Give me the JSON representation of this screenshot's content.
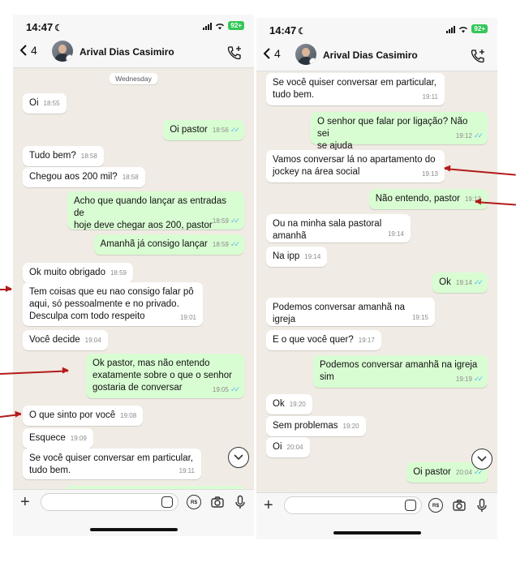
{
  "left": {
    "status": {
      "time": "14:47",
      "battery": "92+"
    },
    "header": {
      "back_count": "4",
      "contact_name": "Arival Dias Casimiro"
    },
    "day_chip": "Wednesday",
    "messages": [
      {
        "dir": "in",
        "text": "Oi",
        "time": "18:55"
      },
      {
        "dir": "out",
        "text": "Oi pastor",
        "time": "18:56",
        "read": true
      },
      {
        "dir": "in",
        "text": "Tudo bem?",
        "time": "18:58"
      },
      {
        "dir": "in",
        "text": "Chegou aos 200 mil?",
        "time": "18:58"
      },
      {
        "dir": "out",
        "text": "Acho que quando lançar as entradas de\nhoje deve chegar aos 200, pastor",
        "time": "18:59",
        "read": true
      },
      {
        "dir": "out",
        "text": "Amanhã já consigo lançar",
        "time": "18:59",
        "read": true
      },
      {
        "dir": "in",
        "text": "Ok muito obrigado",
        "time": "18:59"
      },
      {
        "dir": "in",
        "text": "Tem coisas que eu nao consigo falar pô\naqui, só pessoalmente e no privado.\nDesculpa com todo respeito",
        "time": "19:01"
      },
      {
        "dir": "in",
        "text": "Você decide",
        "time": "19:04"
      },
      {
        "dir": "out",
        "text": "Ok pastor, mas não entendo\nexatamente sobre o que o senhor\ngostaria de conversar",
        "time": "19:05",
        "read": true
      },
      {
        "dir": "in",
        "text": "O que sinto por você",
        "time": "19:08"
      },
      {
        "dir": "in",
        "text": "Esquece",
        "time": "19:09"
      },
      {
        "dir": "in",
        "text": "Se você quiser conversar em particular,\ntudo bem.",
        "time": "19:11"
      }
    ]
  },
  "right": {
    "status": {
      "time": "14:47",
      "battery": "92+"
    },
    "header": {
      "back_count": "4",
      "contact_name": "Arival Dias Casimiro"
    },
    "messages": [
      {
        "dir": "in",
        "text": "Se você quiser conversar em particular,\ntudo bem.",
        "time": "19:11"
      },
      {
        "dir": "out",
        "text": "O senhor que falar por ligação? Não sei\nse ajuda",
        "time": "19:12",
        "read": true
      },
      {
        "dir": "in",
        "text": "Vamos conversar lá no apartamento do\njockey na área social",
        "time": "19:13"
      },
      {
        "dir": "out",
        "text": "Não entendo, pastor",
        "time": "19:13"
      },
      {
        "dir": "in",
        "text": "Ou na minha sala pastoral amanhã",
        "time": "19:14"
      },
      {
        "dir": "in",
        "text": "Na ipp",
        "time": "19:14"
      },
      {
        "dir": "out",
        "text": "Ok",
        "time": "19:14",
        "read": true
      },
      {
        "dir": "in",
        "text": "Podemos conversar amanhã na igreja",
        "time": "19:15"
      },
      {
        "dir": "in",
        "text": "E o que você quer?",
        "time": "19:17"
      },
      {
        "dir": "out",
        "text": "Podemos conversar amanhã na igreja\nsim",
        "time": "19:19",
        "read": true
      },
      {
        "dir": "in",
        "text": "Ok",
        "time": "19:20"
      },
      {
        "dir": "in",
        "text": "Sem problemas",
        "time": "19:20"
      },
      {
        "dir": "in",
        "text": "Oi",
        "time": "20:04"
      },
      {
        "dir": "out",
        "text": "Oi pastor",
        "time": "20:04",
        "read": true
      }
    ]
  },
  "composer": {
    "pay_label": "R$"
  },
  "colors": {
    "incoming": "#ffffff",
    "outgoing": "#d9fdd3",
    "chat_bg": "#f0ebe4",
    "annotation_arrow": "#b31b1b",
    "read_ticks": "#53bdeb"
  },
  "icons": [
    "chevron-left-icon",
    "add-call-icon",
    "plus-icon",
    "sticker-icon",
    "payment-icon",
    "camera-icon",
    "microphone-icon",
    "scroll-down-icon"
  ]
}
